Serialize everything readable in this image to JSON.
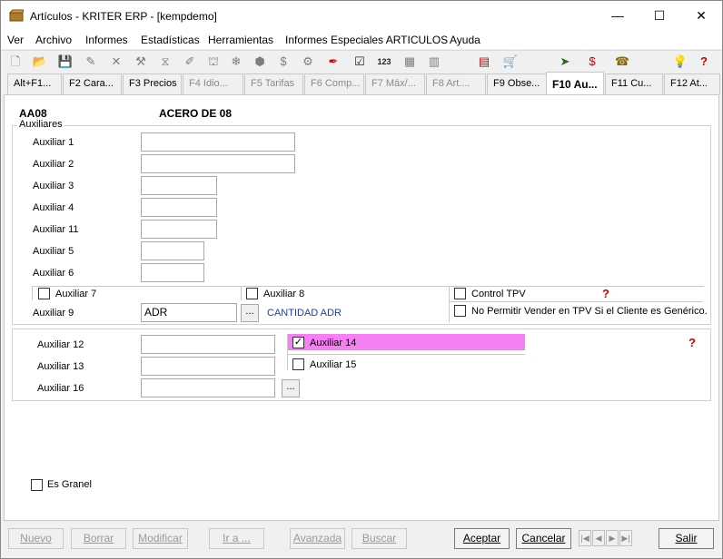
{
  "window": {
    "title": "Artículos - KRITER ERP - [kempdemo]",
    "minimize": "—",
    "maximize": "☐",
    "close": "✕"
  },
  "menu": [
    "Ver",
    "Archivo",
    "Informes",
    "Estadísticas",
    "Herramientas",
    "Informes Especiales ARTICULOS",
    "Ayuda"
  ],
  "tabs": [
    {
      "label": "Alt+F1..."
    },
    {
      "label": "F2 Cara..."
    },
    {
      "label": "F3 Precios"
    },
    {
      "label": "F4 Idio..."
    },
    {
      "label": "F5 Tarifas"
    },
    {
      "label": "F6 Comp..."
    },
    {
      "label": "F7 Máx/..."
    },
    {
      "label": "F8 Art...."
    },
    {
      "label": "F9 Obse..."
    },
    {
      "label": "F10 Au..."
    },
    {
      "label": "F11 Cu..."
    },
    {
      "label": "F12 At..."
    }
  ],
  "article": {
    "code": "AA08",
    "name": "ACERO DE 08"
  },
  "auxiliares": {
    "group_label": "Auxiliares",
    "aux1": {
      "label": "Auxiliar 1",
      "value": ""
    },
    "aux2": {
      "label": "Auxiliar 2",
      "value": ""
    },
    "aux3": {
      "label": "Auxiliar 3",
      "value": ""
    },
    "aux4": {
      "label": "Auxiliar 4",
      "value": ""
    },
    "aux11": {
      "label": "Auxiliar 11",
      "value": ""
    },
    "aux5": {
      "label": "Auxiliar 5",
      "value": ""
    },
    "aux6": {
      "label": "Auxiliar 6",
      "value": ""
    },
    "aux7": {
      "label": "Auxiliar 7",
      "checked": false
    },
    "aux8": {
      "label": "Auxiliar 8",
      "checked": false
    },
    "control_tpv": {
      "label": "Control TPV",
      "checked": false
    },
    "no_permitir": {
      "label": "No Permitir Vender en TPV Si el Cliente es Genérico.",
      "checked": false
    },
    "aux9": {
      "label": "Auxiliar 9",
      "value": "ADR",
      "description": "CANTIDAD ADR"
    },
    "aux12": {
      "label": "Auxiliar 12",
      "value": ""
    },
    "aux13": {
      "label": "Auxiliar 13",
      "value": ""
    },
    "aux16": {
      "label": "Auxiliar 16",
      "value": ""
    },
    "aux14": {
      "label": "Auxiliar 14",
      "checked": true
    },
    "aux15": {
      "label": "Auxiliar 15",
      "checked": false
    },
    "es_granel": {
      "label": "Es Granel",
      "checked": false
    },
    "ellipsis": "..."
  },
  "buttons": {
    "nuevo": "Nuevo",
    "borrar": "Borrar",
    "modificar": "Modificar",
    "ira": "Ir a ...",
    "avanzada": "Avanzada",
    "buscar": "Buscar",
    "aceptar": "Aceptar",
    "cancelar": "Cancelar",
    "salir": "Salir"
  },
  "colors": {
    "highlight": "#f77ff5",
    "link_blue": "#1c3cb4"
  }
}
